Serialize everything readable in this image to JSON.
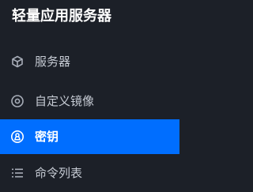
{
  "sidebar": {
    "title": "轻量应用服务器",
    "items": [
      {
        "label": "服务器",
        "icon": "server-icon",
        "active": false
      },
      {
        "label": "自定义镜像",
        "icon": "disc-icon",
        "active": false
      },
      {
        "label": "密钥",
        "icon": "key-icon",
        "active": true
      },
      {
        "label": "命令列表",
        "icon": "list-icon",
        "active": false
      }
    ]
  },
  "colors": {
    "background": "#1c2028",
    "active": "#006eff",
    "text": "#c5cad3",
    "title": "#ffffff"
  }
}
